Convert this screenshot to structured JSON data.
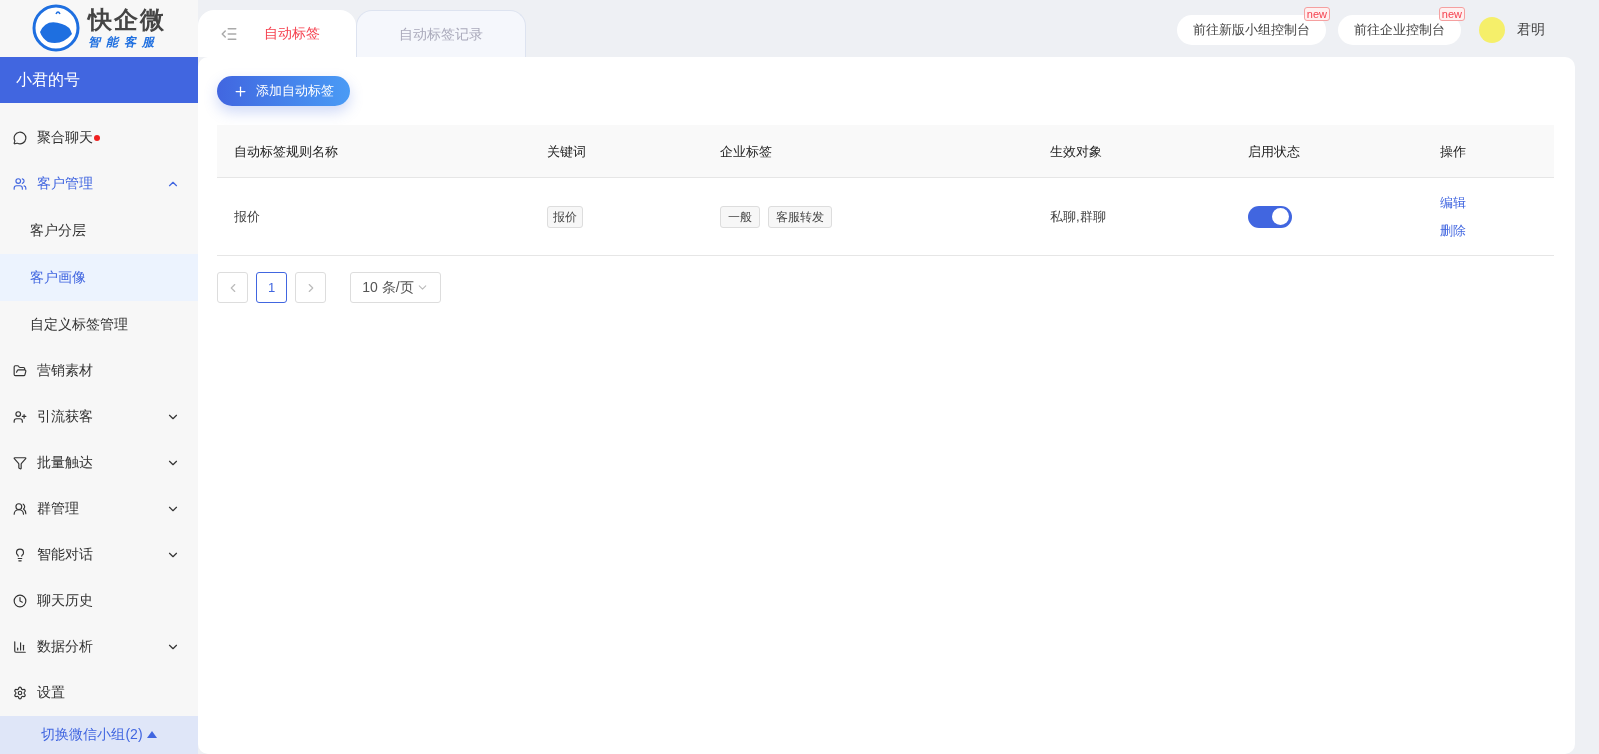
{
  "logo": {
    "title": "快企微",
    "subtitle": "智能客服"
  },
  "account": "小君的号",
  "sidebar": {
    "items": [
      {
        "label": "聚合聊天",
        "dot": true
      },
      {
        "label": "客户管理",
        "expanded": true,
        "children": [
          {
            "label": "客户分层",
            "selected": false
          },
          {
            "label": "客户画像",
            "selected": true
          },
          {
            "label": "自定义标签管理",
            "selected": false
          }
        ]
      },
      {
        "label": "营销素材"
      },
      {
        "label": "引流获客",
        "expanded": false
      },
      {
        "label": "批量触达",
        "expanded": false
      },
      {
        "label": "群管理",
        "expanded": false
      },
      {
        "label": "智能对话",
        "expanded": false
      },
      {
        "label": "聊天历史"
      },
      {
        "label": "数据分析",
        "expanded": false
      },
      {
        "label": "设置"
      }
    ],
    "group_switch": "切换微信小组(2)"
  },
  "tabs": [
    {
      "label": "自动标签",
      "selected": true
    },
    {
      "label": "自动标签记录",
      "selected": false
    }
  ],
  "top_links": [
    {
      "label": "前往新版小组控制台",
      "badge": "new"
    },
    {
      "label": "前往企业控制台",
      "badge": "new"
    }
  ],
  "user": {
    "name": "君明"
  },
  "add_button": "添加自动标签",
  "table": {
    "columns": [
      "自动标签规则名称",
      "关键词",
      "企业标签",
      "生效对象",
      "启用状态",
      "操作"
    ],
    "rows": [
      {
        "name": "报价",
        "keywords": [
          "报价"
        ],
        "tags": [
          "一般",
          "客服转发"
        ],
        "targets": "私聊,群聊",
        "enabled": true,
        "actions": [
          "编辑",
          "删除"
        ]
      }
    ]
  },
  "pagination": {
    "pages": [
      {
        "label": "1",
        "selected": true
      }
    ],
    "page_size": "10 条/页"
  }
}
